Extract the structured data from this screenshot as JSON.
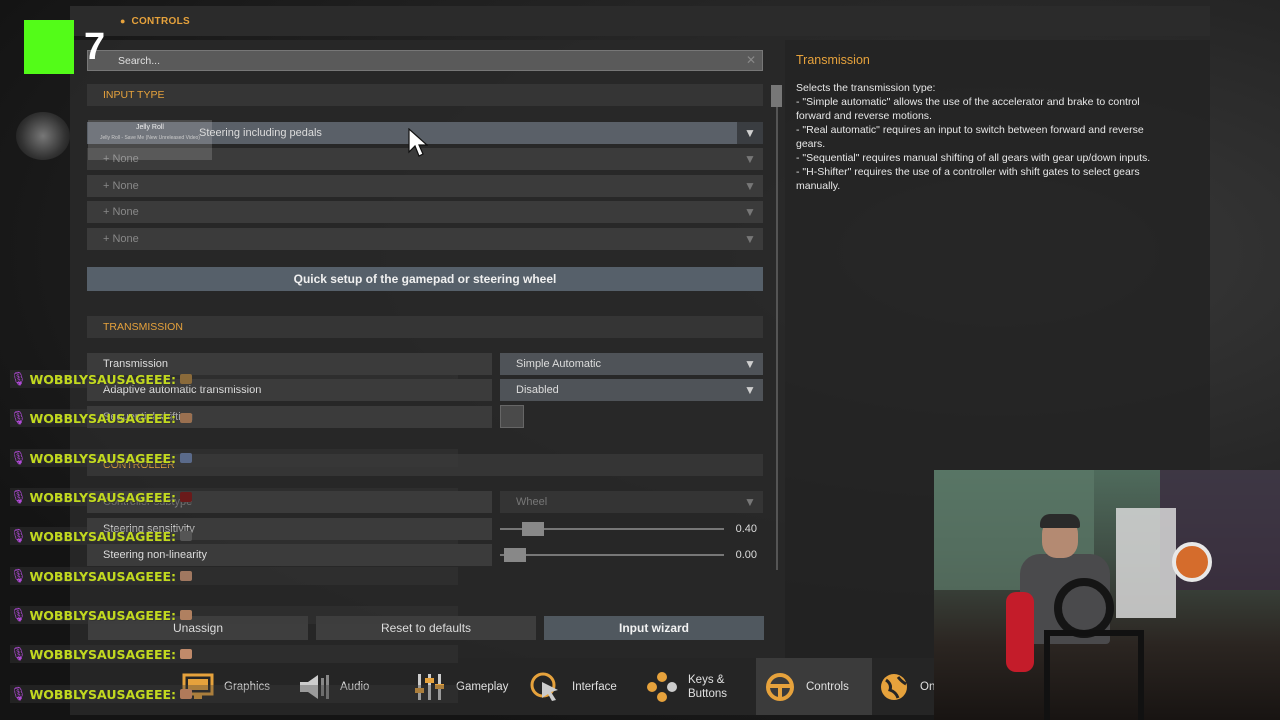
{
  "header": {
    "title": "CONTROLS"
  },
  "search": {
    "text": "Search..."
  },
  "input_type": {
    "title": "INPUT TYPE",
    "selected": "Steering including pedals",
    "slots": [
      "+ None",
      "+ None",
      "+ None",
      "+ None"
    ]
  },
  "quick_setup": "Quick setup of the gamepad or steering wheel",
  "transmission": {
    "title": "TRANSMISSION",
    "rows": [
      {
        "label": "Transmission",
        "value": "Simple Automatic"
      },
      {
        "label": "Adaptive automatic transmission",
        "value": "Disabled"
      },
      {
        "label": "Sequential shifting",
        "value": ""
      }
    ]
  },
  "controller": {
    "title": "CONTROLLER",
    "subtype": {
      "label": "Controller subtype",
      "value": "Wheel"
    },
    "sliders": [
      {
        "label": "Steering sensitivity",
        "value": "0.40",
        "level": 0.4
      },
      {
        "label": "Steering non-linearity",
        "value": "0.00",
        "level": 0
      }
    ]
  },
  "buttons": {
    "unassign": "Unassign",
    "reset": "Reset to defaults",
    "wizard": "Input wizard"
  },
  "info": {
    "title": "Transmission",
    "lines": [
      "Selects the transmission type:",
      "- \"Simple automatic\" allows the use of the accelerator and brake to control",
      "forward and reverse motions.",
      "- \"Real automatic\" requires an input to switch between forward and reverse",
      "gears.",
      "- \"Sequential\" requires manual shifting of all gears with gear up/down inputs.",
      "- \"H-Shifter\" requires the use of a controller with shift gates to select gears",
      "manually."
    ]
  },
  "nav": [
    {
      "label": "Graphics",
      "icon": "monitor-icon"
    },
    {
      "label": "Audio",
      "icon": "speaker-icon"
    },
    {
      "label": "Gameplay",
      "icon": "sliders-icon"
    },
    {
      "label": "Interface",
      "icon": "cursor-click-icon"
    },
    {
      "label": "Keys &",
      "label2": "Buttons",
      "icon": "gamepad-buttons-icon"
    },
    {
      "label": "Controls",
      "icon": "steering-wheel-icon"
    },
    {
      "label": "On",
      "icon": "globe-icon"
    }
  ],
  "overlay": {
    "logo_number": "7",
    "music_title": "Jelly Roll",
    "music_sub": "Jelly Roll - Save Me (New Unreleased Video)",
    "chat_name": "WOBBLYSAUSAGEEE:",
    "chat_count": 9
  },
  "colors": {
    "accent": "#e6a23c",
    "kick_green": "#53fc18",
    "chat_name": "#c2d91f"
  }
}
